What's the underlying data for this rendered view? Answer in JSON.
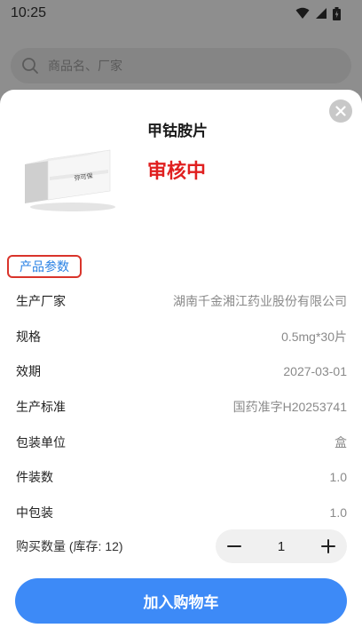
{
  "status_bar": {
    "time": "10:25",
    "icons": [
      "wifi-icon",
      "signal-icon",
      "battery-icon"
    ]
  },
  "search": {
    "placeholder": "商品名、厂家"
  },
  "product": {
    "name": "甲钴胺片",
    "status": "审核中",
    "status_color": "#e02020",
    "box_label": "弥可保"
  },
  "section": {
    "title": "产品参数"
  },
  "params": [
    {
      "label": "生产厂家",
      "value": "湖南千金湘江药业股份有限公司"
    },
    {
      "label": "规格",
      "value": "0.5mg*30片"
    },
    {
      "label": "效期",
      "value": "2027-03-01"
    },
    {
      "label": "生产标准",
      "value": "国药准字H20253741"
    },
    {
      "label": "包装单位",
      "value": "盒"
    },
    {
      "label": "件装数",
      "value": "1.0"
    },
    {
      "label": "中包装",
      "value": "1.0"
    }
  ],
  "quantity": {
    "label": "购买数量 (库存: 12)",
    "value": "1"
  },
  "cart": {
    "button_label": "加入购物车",
    "accent": "#3d8af7"
  }
}
